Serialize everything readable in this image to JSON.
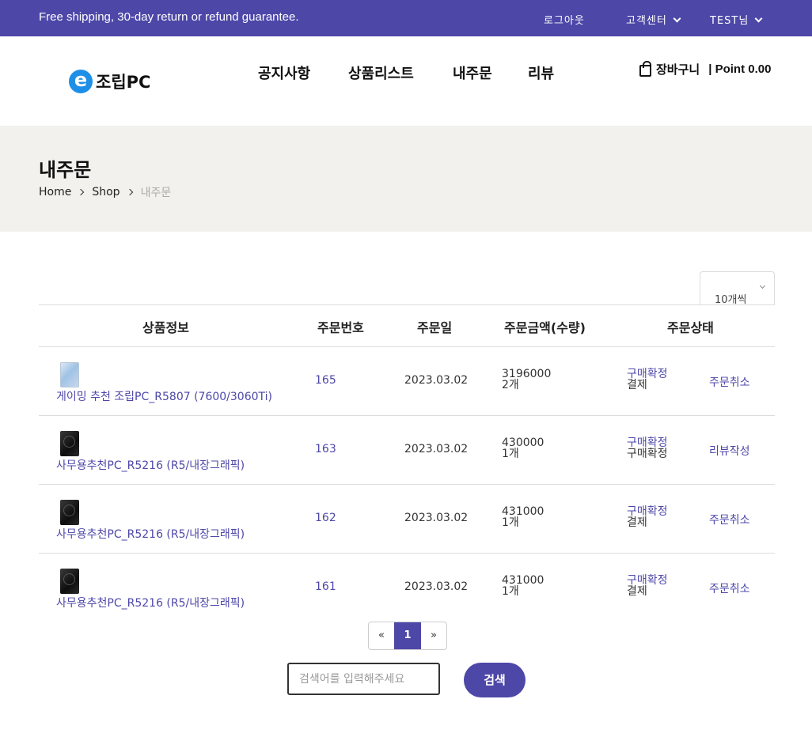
{
  "topbar": {
    "promo": "Free shipping, 30-day return or refund guarantee.",
    "logout": "로그아웃",
    "support": "고객센터",
    "user": "TEST님"
  },
  "header": {
    "logo_mark": "e",
    "logo_text": "조립PC",
    "nav": [
      "공지사항",
      "상품리스트",
      "내주문",
      "리뷰"
    ],
    "cart_label": "장바구니",
    "point_label": "| Point 0.00"
  },
  "banner": {
    "title": "내주문",
    "breadcrumb": [
      "Home",
      "Shop",
      "내주문"
    ]
  },
  "per_page": "10개씩",
  "table": {
    "headers": [
      "상품정보",
      "주문번호",
      "주문일",
      "주문금액(수량)",
      "주문상태"
    ],
    "rows": [
      {
        "product": "게이밍 추천 조립PC_R5807 (7600/3060Ti)",
        "order_no": "165",
        "date": "2023.03.02",
        "amount": "3196000",
        "qty": "2개",
        "status1": "구매확정",
        "status2": "결제",
        "action": "주문취소",
        "thumb": "pc-case-white-icon"
      },
      {
        "product": "사무용추천PC_R5216 (R5/내장그래픽)",
        "order_no": "163",
        "date": "2023.03.02",
        "amount": "430000",
        "qty": "1개",
        "status1": "구매확정",
        "status2": "구매확정",
        "action": "리뷰작성",
        "thumb": "pc-case-black-icon"
      },
      {
        "product": "사무용추천PC_R5216 (R5/내장그래픽)",
        "order_no": "162",
        "date": "2023.03.02",
        "amount": "431000",
        "qty": "1개",
        "status1": "구매확정",
        "status2": "결제",
        "action": "주문취소",
        "thumb": "pc-case-black-icon"
      },
      {
        "product": "사무용추천PC_R5216 (R5/내장그래픽)",
        "order_no": "161",
        "date": "2023.03.02",
        "amount": "431000",
        "qty": "1개",
        "status1": "구매확정",
        "status2": "결제",
        "action": "주문취소",
        "thumb": "pc-case-black-icon"
      }
    ]
  },
  "pagination": {
    "prev": "«",
    "current": "1",
    "next": "»"
  },
  "search": {
    "placeholder": "검색어를 입력해주세요",
    "button": "검색"
  },
  "colors": {
    "accent": "#4d47a8",
    "banner_bg": "#f2f1ee",
    "logo_blue": "#1e8fe6"
  }
}
